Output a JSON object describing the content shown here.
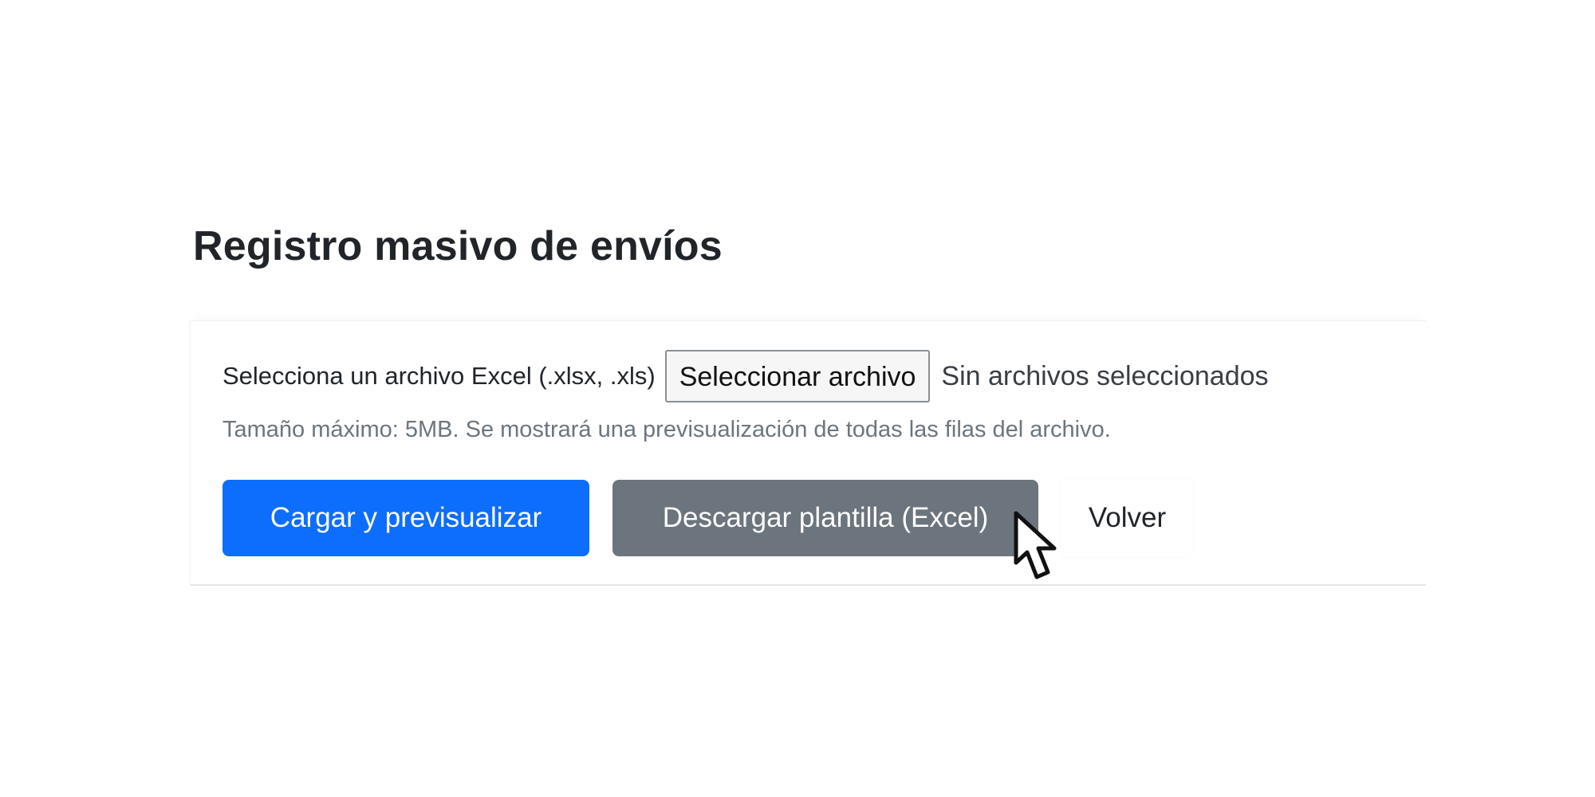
{
  "page": {
    "title": "Registro masivo de envíos"
  },
  "upload": {
    "label": "Selecciona un archivo Excel (.xlsx, .xls)",
    "choose_button": "Seleccionar archivo",
    "file_status": "Sin archivos seleccionados",
    "help": "Tamaño máximo: 5MB. Se mostrará una previsualización de todas las filas del archivo."
  },
  "actions": {
    "upload_preview": "Cargar y previsualizar",
    "download_template": "Descargar plantilla (Excel)",
    "back": "Volver"
  },
  "colors": {
    "primary": "#0d6efd",
    "secondary": "#6c757d",
    "title": "#212529",
    "muted": "#6c757d"
  },
  "icons": {
    "pointer": "mouse-pointer-icon"
  }
}
